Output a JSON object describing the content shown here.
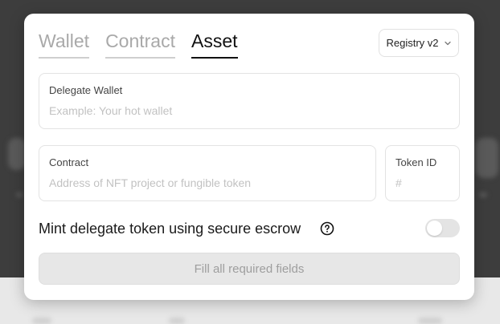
{
  "tabs": [
    {
      "label": "Wallet",
      "active": false
    },
    {
      "label": "Contract",
      "active": false
    },
    {
      "label": "Asset",
      "active": true
    }
  ],
  "registry": {
    "label": "Registry v2",
    "icon": "chevron-down-icon"
  },
  "fields": {
    "delegate_wallet": {
      "label": "Delegate Wallet",
      "placeholder": "Example: Your hot wallet",
      "value": ""
    },
    "contract": {
      "label": "Contract",
      "placeholder": "Address of NFT project or fungible token",
      "value": ""
    },
    "token_id": {
      "label": "Token ID",
      "placeholder": "#",
      "value": ""
    }
  },
  "escrow": {
    "label": "Mint delegate token using secure escrow",
    "help_icon": "question-circle-icon",
    "enabled": false
  },
  "submit": {
    "label": "Fill all required fields",
    "disabled": true
  },
  "colors": {
    "overlay": "#3d3d3d",
    "active_tab": "#111111",
    "inactive_tab": "#a9a9a9",
    "disabled_button": "#e7e7e7"
  }
}
